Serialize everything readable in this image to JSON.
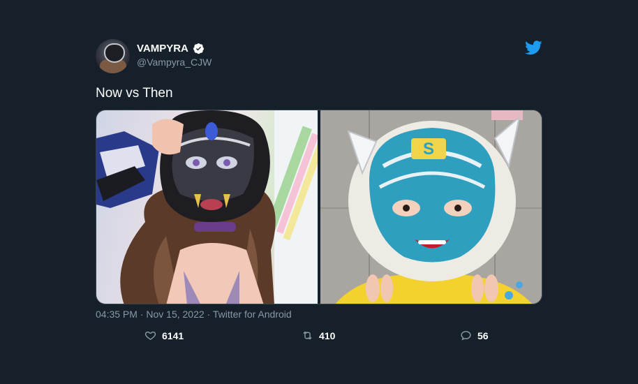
{
  "tweet": {
    "author": {
      "name": "VAMPYRA",
      "handle": "@Vampyra_CJW",
      "verified": true
    },
    "text": "Now vs Then",
    "timestamp": "04:35 PM · Nov 15, 2022 · Twitter for Android",
    "stats": {
      "likes": "6141",
      "retweets": "410",
      "replies": "56"
    },
    "media": [
      "photo-now",
      "photo-then"
    ]
  },
  "colors": {
    "background": "#15202b",
    "brand": "#1d9bf0",
    "muted": "#8b98a5",
    "border": "#38444d"
  },
  "icons": [
    "twitter-bird-icon",
    "verified-badge-icon",
    "heart-icon",
    "retweet-icon",
    "reply-icon"
  ]
}
